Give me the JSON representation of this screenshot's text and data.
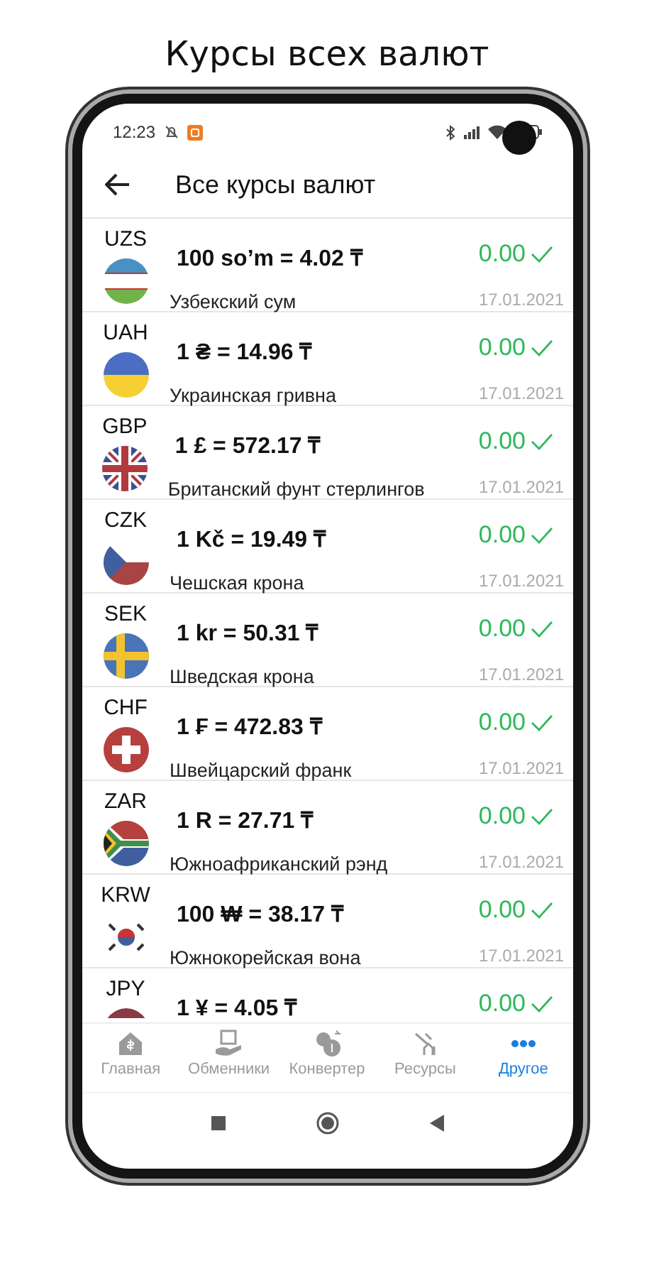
{
  "headline": "Курсы всех валют",
  "status_bar": {
    "time": "12:23"
  },
  "header": {
    "title": "Все курсы валют"
  },
  "rates": [
    {
      "code": "UZS",
      "kind": "uzbekistan",
      "rate": "100 so’m = 4.02 ₸",
      "name": "Узбекский сум",
      "change": "0.00",
      "date": "17.01.2021"
    },
    {
      "code": "UAH",
      "kind": "ukraine",
      "rate": "1 ₴ = 14.96 ₸",
      "name": "Украинская гривна",
      "change": "0.00",
      "date": "17.01.2021"
    },
    {
      "code": "GBP",
      "kind": "britain",
      "rate": "1 £ = 572.17 ₸",
      "name": "Британский фунт стерлингов",
      "change": "0.00",
      "date": "17.01.2021"
    },
    {
      "code": "CZK",
      "kind": "czechia",
      "rate": "1 Kč = 19.49 ₸",
      "name": "Чешская крона",
      "change": "0.00",
      "date": "17.01.2021"
    },
    {
      "code": "SEK",
      "kind": "sweden",
      "rate": "1 kr = 50.31 ₸",
      "name": "Шведская крона",
      "change": "0.00",
      "date": "17.01.2021"
    },
    {
      "code": "CHF",
      "kind": "switzerland",
      "rate": "1 ₣ = 472.83 ₸",
      "name": "Швейцарский франк",
      "change": "0.00",
      "date": "17.01.2021"
    },
    {
      "code": "ZAR",
      "kind": "southafrica",
      "rate": "1 R = 27.71 ₸",
      "name": "Южноафриканский рэнд",
      "change": "0.00",
      "date": "17.01.2021"
    },
    {
      "code": "KRW",
      "kind": "korea",
      "rate": "100 ₩ = 38.17 ₸",
      "name": "Южнокорейская вона",
      "change": "0.00",
      "date": "17.01.2021"
    },
    {
      "code": "JPY",
      "kind": "japan",
      "rate": "1 ¥ = 4.05 ₸",
      "change": "0.00"
    }
  ],
  "bottom_nav": [
    {
      "label": "Главная",
      "kind": "home",
      "selected": false
    },
    {
      "label": "Обменники",
      "kind": "exchange",
      "selected": false
    },
    {
      "label": "Конвертер",
      "kind": "converter",
      "selected": false
    },
    {
      "label": "Ресурсы",
      "kind": "resources",
      "selected": false
    },
    {
      "label": "Другое",
      "kind": "more",
      "selected": true
    }
  ]
}
